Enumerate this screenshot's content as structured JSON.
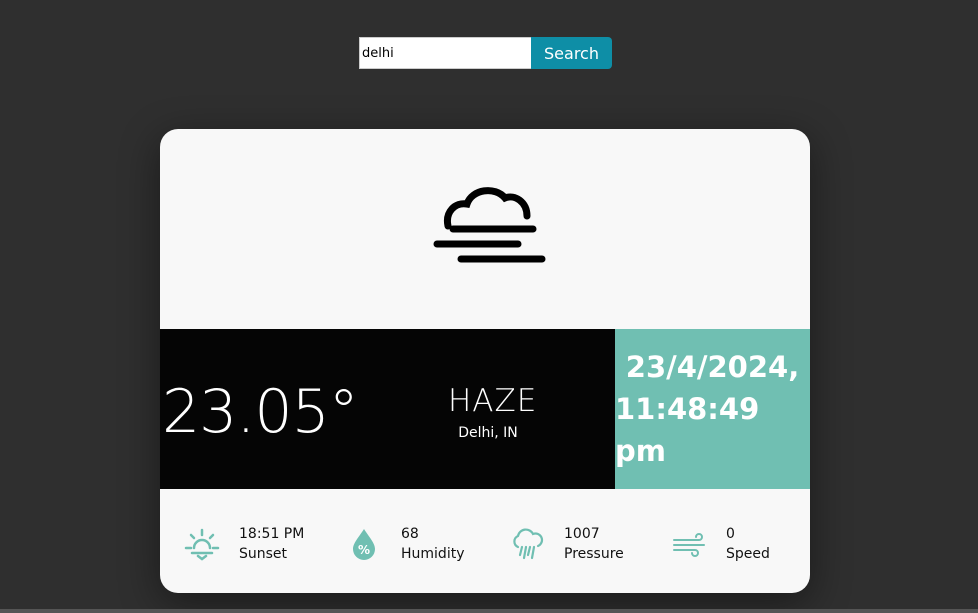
{
  "search": {
    "value": "delhi",
    "button_label": "Search"
  },
  "weather": {
    "temperature": "23.05°",
    "condition": "HAZE",
    "location": "Delhi, IN",
    "date": "23/4/2024,",
    "time": "11:48:49 pm"
  },
  "stats": [
    {
      "value": "18:51 PM",
      "label": "Sunset",
      "icon": "sunset-icon"
    },
    {
      "value": "68",
      "label": "Humidity",
      "icon": "humidity-icon"
    },
    {
      "value": "1007",
      "label": "Pressure",
      "icon": "rain-cloud-icon"
    },
    {
      "value": "0",
      "label": "Speed",
      "icon": "wind-icon"
    }
  ],
  "colors": {
    "accent": "#70bfb2",
    "button": "#0e8ea6",
    "background": "#2f2f2f"
  }
}
